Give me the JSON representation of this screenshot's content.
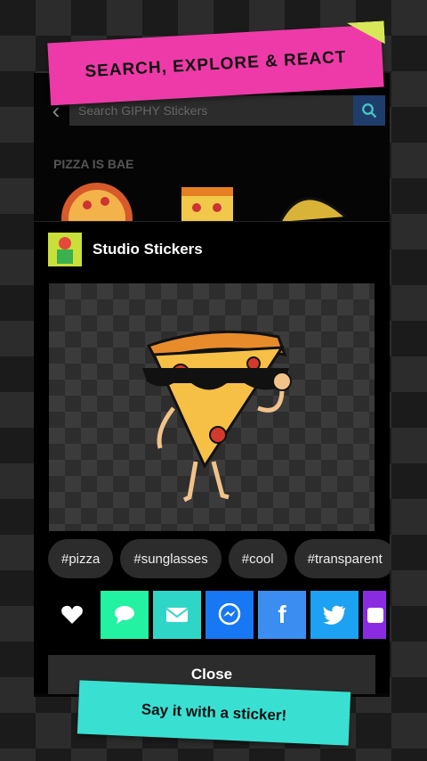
{
  "search": {
    "placeholder": "Search GIPHY Stickers"
  },
  "section": {
    "title": "PIZZA IS BAE"
  },
  "banner_top": {
    "text": "SEARCH, EXPLORE & REACT"
  },
  "modal": {
    "title": "Studio Stickers",
    "tags": [
      "#pizza",
      "#sunglasses",
      "#cool",
      "#transparent"
    ],
    "close_label": "Close"
  },
  "share": [
    {
      "icon": "heart-icon",
      "color": "#000000"
    },
    {
      "icon": "message-icon",
      "color": "#22f2a2"
    },
    {
      "icon": "mail-icon",
      "color": "#2fd6c8"
    },
    {
      "icon": "messenger-icon",
      "color": "#1877f2"
    },
    {
      "icon": "facebook-icon",
      "color": "#3b8df2"
    },
    {
      "icon": "twitter-icon",
      "color": "#1da1f2"
    },
    {
      "icon": "instagram-icon",
      "color": "#8a2be2"
    }
  ],
  "banner_bottom": {
    "text": "Say it with a sticker!"
  },
  "colors": {
    "accent_pink": "#ee3aa8",
    "accent_teal": "#39e0d2",
    "accent_yellow": "#c9e03a"
  }
}
